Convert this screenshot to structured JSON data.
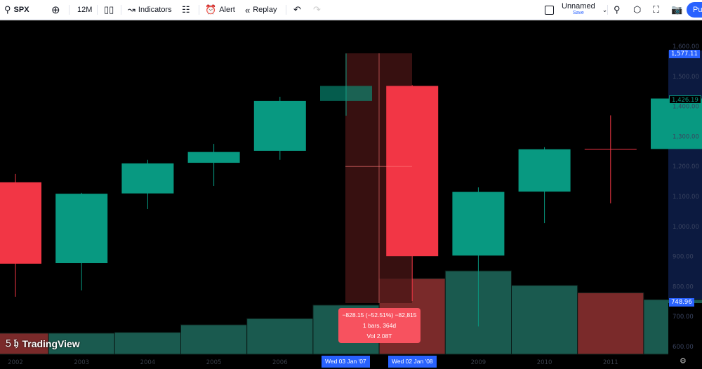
{
  "toolbar": {
    "symbol": "SPX",
    "interval": "12M",
    "indicators": "Indicators",
    "alert": "Alert",
    "replay": "Replay",
    "layout_name": "Unnamed",
    "save": "Save",
    "publish": "Pu"
  },
  "colors": {
    "up": "#089981",
    "down": "#f23645",
    "accent": "#2962ff",
    "selection": "#4a1616",
    "axis_shade": "#0c1a40"
  },
  "chart_data": {
    "type": "candlestick",
    "symbol": "SPX",
    "x": [
      "2002",
      "2003",
      "2004",
      "2005",
      "2006",
      "2007",
      "2008",
      "2009",
      "2010",
      "2011",
      "2012"
    ],
    "open": [
      1147,
      878,
      1110,
      1212,
      1252,
      1418,
      1468,
      903,
      1116,
      1258,
      1258
    ],
    "high": [
      1175,
      1112,
      1222,
      1275,
      1432,
      1576,
      1471,
      1130,
      1264,
      1370,
      1426
    ],
    "low": [
      766,
      787,
      1058,
      1135,
      1222,
      1369,
      752,
      667,
      1011,
      1077,
      1258
    ],
    "close": [
      876,
      1109,
      1210,
      1248,
      1418,
      1468,
      901,
      1115,
      1257,
      1257,
      1426
    ],
    "volume_T": [
      0.58,
      0.58,
      0.6,
      0.81,
      0.98,
      1.35,
      2.08,
      2.29,
      1.89,
      1.69,
      1.5
    ],
    "ylim": [
      600,
      1600
    ],
    "y_ticks": [
      "1,600.00",
      "1,500.00",
      "1,400.00",
      "1,300.00",
      "1,200.00",
      "1,100.00",
      "1,000.00",
      "900.00",
      "800.00",
      "700.00",
      "600.00"
    ],
    "x_ticks": [
      "2002",
      "2003",
      "2004",
      "2005",
      "2006",
      "2007",
      "2008",
      "2009",
      "2010",
      "2011"
    ],
    "price_tags": {
      "high": "1,577.11",
      "last": "1,426.19",
      "low": "748.96"
    },
    "crosshair_price": 1200
  },
  "measure": {
    "line1": "−828.15 (−52.51%) −82,815",
    "line2": "1 bars, 364d",
    "line3": "Vol 2.08T",
    "start_date": "Wed 03 Jan '07",
    "end_date": "Wed 02 Jan '08"
  },
  "logo": "TradingView"
}
